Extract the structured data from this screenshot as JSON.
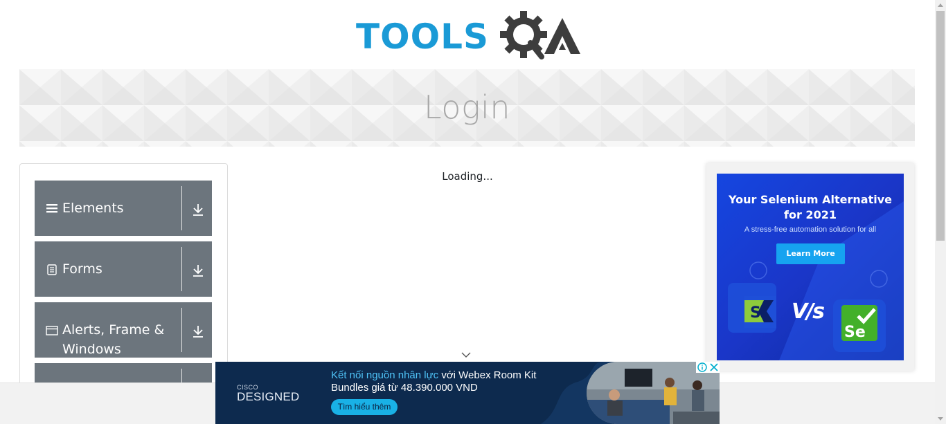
{
  "logo": {
    "text": "TOOLS",
    "suffix": "QA",
    "colors": {
      "blue": "#1a9ad6",
      "dark": "#3d3d3d"
    }
  },
  "banner": {
    "title": "Login"
  },
  "nav": {
    "groups": [
      {
        "label": "Elements",
        "icon": "menu-lines-icon"
      },
      {
        "label": "Forms",
        "icon": "document-icon"
      },
      {
        "label": "Alerts, Frame & Windows",
        "icon": "window-icon"
      },
      {
        "label": "",
        "icon": ""
      }
    ],
    "expand_icon": "download-arrow-icon",
    "group_color": "#6c757d"
  },
  "main": {
    "status_text": "Loading..."
  },
  "right_ad": {
    "title_line1": "Your Selenium Alternative",
    "title_line2": "for 2021",
    "subtitle": "A stress-free automation solution for all",
    "button_label": "Learn More",
    "vs_text": "V/s",
    "left_logo_letter": "S",
    "right_logo_text": "Se"
  },
  "bottom_ad": {
    "brand_small": "CISCO",
    "brand_large": "DESIGNED",
    "headline_highlight": "Kết nối nguồn nhân lực",
    "headline_rest": " với Webex Room Kit",
    "line2": "Bundles giá từ 48.390.000 VND",
    "button_label": "Tìm hiểu thêm"
  }
}
